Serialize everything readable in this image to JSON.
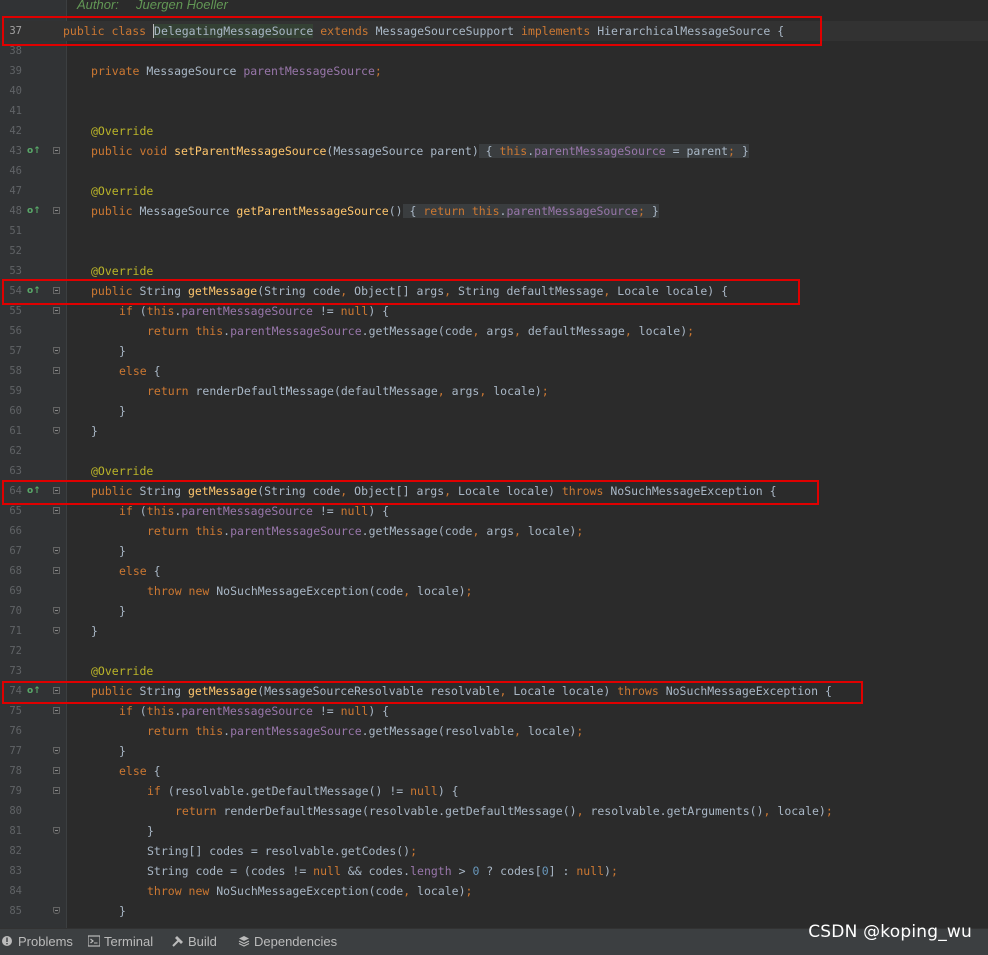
{
  "doc": {
    "author_label": "Author:",
    "author_value": "Juergen Hoeller"
  },
  "lines": [
    {
      "num": "37",
      "current": true,
      "tokens": [
        {
          "c": "kw",
          "t": "public class "
        },
        {
          "c": "caret selword",
          "t": "D"
        },
        {
          "c": "selword",
          "t": "elegatingMessageSource"
        },
        {
          "c": "",
          "t": " "
        },
        {
          "c": "kw",
          "t": "extends "
        },
        {
          "c": "",
          "t": "MessageSourceSupport "
        },
        {
          "c": "kw",
          "t": "implements "
        },
        {
          "c": "",
          "t": "HierarchicalMessageSource {"
        }
      ]
    },
    {
      "num": "38",
      "tokens": []
    },
    {
      "num": "39",
      "tokens": [
        {
          "c": "kw",
          "t": "private "
        },
        {
          "c": "",
          "t": "MessageSource "
        },
        {
          "c": "fld",
          "t": "parentMessageSource"
        },
        {
          "c": "kw",
          "t": ";"
        }
      ]
    },
    {
      "num": "40",
      "tokens": []
    },
    {
      "num": "41",
      "tokens": []
    },
    {
      "num": "42",
      "tokens": [
        {
          "c": "ann",
          "t": "@Override"
        }
      ]
    },
    {
      "num": "43",
      "tokens": [
        {
          "c": "kw",
          "t": "public void "
        },
        {
          "c": "fn",
          "t": "setParentMessageSource"
        },
        {
          "c": "",
          "t": "(MessageSource parent)"
        },
        {
          "c": "fold-bg",
          "t": " { "
        },
        {
          "c": "kw fold-bg",
          "t": "this"
        },
        {
          "c": "fold-bg",
          "t": "."
        },
        {
          "c": "fld fold-bg",
          "t": "parentMessageSource"
        },
        {
          "c": "fold-bg",
          "t": " = parent"
        },
        {
          "c": "kw fold-bg",
          "t": "; "
        },
        {
          "c": "fold-bg",
          "t": "}"
        }
      ]
    },
    {
      "num": "46",
      "tokens": []
    },
    {
      "num": "47",
      "tokens": [
        {
          "c": "ann",
          "t": "@Override"
        }
      ]
    },
    {
      "num": "48",
      "tokens": [
        {
          "c": "kw",
          "t": "public "
        },
        {
          "c": "",
          "t": "MessageSource "
        },
        {
          "c": "fn",
          "t": "getParentMessageSource"
        },
        {
          "c": "",
          "t": "()"
        },
        {
          "c": "fold-bg",
          "t": " { "
        },
        {
          "c": "kw fold-bg",
          "t": "return this"
        },
        {
          "c": "fold-bg",
          "t": "."
        },
        {
          "c": "fld fold-bg",
          "t": "parentMessageSource"
        },
        {
          "c": "kw fold-bg",
          "t": "; "
        },
        {
          "c": "fold-bg",
          "t": "}"
        }
      ]
    },
    {
      "num": "51",
      "tokens": []
    },
    {
      "num": "52",
      "tokens": []
    },
    {
      "num": "53",
      "tokens": [
        {
          "c": "ann",
          "t": "@Override"
        }
      ]
    },
    {
      "num": "54",
      "tokens": [
        {
          "c": "kw",
          "t": "public "
        },
        {
          "c": "",
          "t": "String "
        },
        {
          "c": "fn",
          "t": "getMessage"
        },
        {
          "c": "",
          "t": "(String code"
        },
        {
          "c": "kw",
          "t": ", "
        },
        {
          "c": "",
          "t": "Object[] args"
        },
        {
          "c": "kw",
          "t": ", "
        },
        {
          "c": "",
          "t": "String defaultMessage"
        },
        {
          "c": "kw",
          "t": ", "
        },
        {
          "c": "",
          "t": "Locale locale) {"
        }
      ]
    },
    {
      "num": "55",
      "tokens": [
        {
          "c": "kw",
          "t": "if "
        },
        {
          "c": "",
          "t": "("
        },
        {
          "c": "kw",
          "t": "this"
        },
        {
          "c": "",
          "t": "."
        },
        {
          "c": "fld",
          "t": "parentMessageSource "
        },
        {
          "c": "",
          "t": "!= "
        },
        {
          "c": "kw",
          "t": "null"
        },
        {
          "c": "",
          "t": ") {"
        }
      ]
    },
    {
      "num": "56",
      "tokens": [
        {
          "c": "kw",
          "t": "return this"
        },
        {
          "c": "",
          "t": "."
        },
        {
          "c": "fld",
          "t": "parentMessageSource"
        },
        {
          "c": "",
          "t": ".getMessage(code"
        },
        {
          "c": "kw",
          "t": ", "
        },
        {
          "c": "",
          "t": "args"
        },
        {
          "c": "kw",
          "t": ", "
        },
        {
          "c": "",
          "t": "defaultMessage"
        },
        {
          "c": "kw",
          "t": ", "
        },
        {
          "c": "",
          "t": "locale)"
        },
        {
          "c": "kw",
          "t": ";"
        }
      ]
    },
    {
      "num": "57",
      "tokens": [
        {
          "c": "",
          "t": "}"
        }
      ]
    },
    {
      "num": "58",
      "tokens": [
        {
          "c": "kw",
          "t": "else "
        },
        {
          "c": "",
          "t": "{"
        }
      ]
    },
    {
      "num": "59",
      "tokens": [
        {
          "c": "kw",
          "t": "return "
        },
        {
          "c": "",
          "t": "renderDefaultMessage(defaultMessage"
        },
        {
          "c": "kw",
          "t": ", "
        },
        {
          "c": "",
          "t": "args"
        },
        {
          "c": "kw",
          "t": ", "
        },
        {
          "c": "",
          "t": "locale)"
        },
        {
          "c": "kw",
          "t": ";"
        }
      ]
    },
    {
      "num": "60",
      "tokens": [
        {
          "c": "",
          "t": "}"
        }
      ]
    },
    {
      "num": "61",
      "tokens": [
        {
          "c": "",
          "t": "}"
        }
      ]
    },
    {
      "num": "62",
      "tokens": []
    },
    {
      "num": "63",
      "tokens": [
        {
          "c": "ann",
          "t": "@Override"
        }
      ]
    },
    {
      "num": "64",
      "tokens": [
        {
          "c": "kw",
          "t": "public "
        },
        {
          "c": "",
          "t": "String "
        },
        {
          "c": "fn",
          "t": "getMessage"
        },
        {
          "c": "",
          "t": "(String code"
        },
        {
          "c": "kw",
          "t": ", "
        },
        {
          "c": "",
          "t": "Object[] args"
        },
        {
          "c": "kw",
          "t": ", "
        },
        {
          "c": "",
          "t": "Locale locale) "
        },
        {
          "c": "kw",
          "t": "throws "
        },
        {
          "c": "",
          "t": "NoSuchMessageException {"
        }
      ]
    },
    {
      "num": "65",
      "tokens": [
        {
          "c": "kw",
          "t": "if "
        },
        {
          "c": "",
          "t": "("
        },
        {
          "c": "kw",
          "t": "this"
        },
        {
          "c": "",
          "t": "."
        },
        {
          "c": "fld",
          "t": "parentMessageSource "
        },
        {
          "c": "",
          "t": "!= "
        },
        {
          "c": "kw",
          "t": "null"
        },
        {
          "c": "",
          "t": ") {"
        }
      ]
    },
    {
      "num": "66",
      "tokens": [
        {
          "c": "kw",
          "t": "return this"
        },
        {
          "c": "",
          "t": "."
        },
        {
          "c": "fld",
          "t": "parentMessageSource"
        },
        {
          "c": "",
          "t": ".getMessage(code"
        },
        {
          "c": "kw",
          "t": ", "
        },
        {
          "c": "",
          "t": "args"
        },
        {
          "c": "kw",
          "t": ", "
        },
        {
          "c": "",
          "t": "locale)"
        },
        {
          "c": "kw",
          "t": ";"
        }
      ]
    },
    {
      "num": "67",
      "tokens": [
        {
          "c": "",
          "t": "}"
        }
      ]
    },
    {
      "num": "68",
      "tokens": [
        {
          "c": "kw",
          "t": "else "
        },
        {
          "c": "",
          "t": "{"
        }
      ]
    },
    {
      "num": "69",
      "tokens": [
        {
          "c": "kw",
          "t": "throw new "
        },
        {
          "c": "",
          "t": "NoSuchMessageException(code"
        },
        {
          "c": "kw",
          "t": ", "
        },
        {
          "c": "",
          "t": "locale)"
        },
        {
          "c": "kw",
          "t": ";"
        }
      ]
    },
    {
      "num": "70",
      "tokens": [
        {
          "c": "",
          "t": "}"
        }
      ]
    },
    {
      "num": "71",
      "tokens": [
        {
          "c": "",
          "t": "}"
        }
      ]
    },
    {
      "num": "72",
      "tokens": []
    },
    {
      "num": "73",
      "tokens": [
        {
          "c": "ann",
          "t": "@Override"
        }
      ]
    },
    {
      "num": "74",
      "tokens": [
        {
          "c": "kw",
          "t": "public "
        },
        {
          "c": "",
          "t": "String "
        },
        {
          "c": "fn",
          "t": "getMessage"
        },
        {
          "c": "",
          "t": "(MessageSourceResolvable resolvable"
        },
        {
          "c": "kw",
          "t": ", "
        },
        {
          "c": "",
          "t": "Locale locale) "
        },
        {
          "c": "kw",
          "t": "throws "
        },
        {
          "c": "",
          "t": "NoSuchMessageException {"
        }
      ]
    },
    {
      "num": "75",
      "tokens": [
        {
          "c": "kw",
          "t": "if "
        },
        {
          "c": "",
          "t": "("
        },
        {
          "c": "kw",
          "t": "this"
        },
        {
          "c": "",
          "t": "."
        },
        {
          "c": "fld",
          "t": "parentMessageSource "
        },
        {
          "c": "",
          "t": "!= "
        },
        {
          "c": "kw",
          "t": "null"
        },
        {
          "c": "",
          "t": ") {"
        }
      ]
    },
    {
      "num": "76",
      "tokens": [
        {
          "c": "kw",
          "t": "return this"
        },
        {
          "c": "",
          "t": "."
        },
        {
          "c": "fld",
          "t": "parentMessageSource"
        },
        {
          "c": "",
          "t": ".getMessage(resolvable"
        },
        {
          "c": "kw",
          "t": ", "
        },
        {
          "c": "",
          "t": "locale)"
        },
        {
          "c": "kw",
          "t": ";"
        }
      ]
    },
    {
      "num": "77",
      "tokens": [
        {
          "c": "",
          "t": "}"
        }
      ]
    },
    {
      "num": "78",
      "tokens": [
        {
          "c": "kw",
          "t": "else "
        },
        {
          "c": "",
          "t": "{"
        }
      ]
    },
    {
      "num": "79",
      "tokens": [
        {
          "c": "kw",
          "t": "if "
        },
        {
          "c": "",
          "t": "(resolvable.getDefaultMessage() != "
        },
        {
          "c": "kw",
          "t": "null"
        },
        {
          "c": "",
          "t": ") {"
        }
      ]
    },
    {
      "num": "80",
      "tokens": [
        {
          "c": "kw",
          "t": "return "
        },
        {
          "c": "",
          "t": "renderDefaultMessage(resolvable.getDefaultMessage()"
        },
        {
          "c": "kw",
          "t": ", "
        },
        {
          "c": "",
          "t": "resolvable.getArguments()"
        },
        {
          "c": "kw",
          "t": ", "
        },
        {
          "c": "",
          "t": "locale)"
        },
        {
          "c": "kw",
          "t": ";"
        }
      ]
    },
    {
      "num": "81",
      "tokens": [
        {
          "c": "",
          "t": "}"
        }
      ]
    },
    {
      "num": "82",
      "tokens": [
        {
          "c": "",
          "t": "String[] codes = resolvable.getCodes()"
        },
        {
          "c": "kw",
          "t": ";"
        }
      ]
    },
    {
      "num": "83",
      "tokens": [
        {
          "c": "",
          "t": "String code = (codes != "
        },
        {
          "c": "kw",
          "t": "null "
        },
        {
          "c": "",
          "t": "&& codes."
        },
        {
          "c": "fld",
          "t": "length "
        },
        {
          "c": "",
          "t": "> "
        },
        {
          "c": "num",
          "t": "0 "
        },
        {
          "c": "",
          "t": "? codes["
        },
        {
          "c": "num",
          "t": "0"
        },
        {
          "c": "",
          "t": "] : "
        },
        {
          "c": "kw",
          "t": "null"
        },
        {
          "c": "",
          "t": ")"
        },
        {
          "c": "kw",
          "t": ";"
        }
      ]
    },
    {
      "num": "84",
      "tokens": [
        {
          "c": "kw",
          "t": "throw new "
        },
        {
          "c": "",
          "t": "NoSuchMessageException(code"
        },
        {
          "c": "kw",
          "t": ", "
        },
        {
          "c": "",
          "t": "locale)"
        },
        {
          "c": "kw",
          "t": ";"
        }
      ]
    },
    {
      "num": "85",
      "tokens": [
        {
          "c": "",
          "t": "}"
        }
      ]
    }
  ],
  "status": {
    "problems": "Problems",
    "terminal": "Terminal",
    "build": "Build",
    "dependencies": "Dependencies"
  },
  "watermark": "CSDN @koping_wu"
}
